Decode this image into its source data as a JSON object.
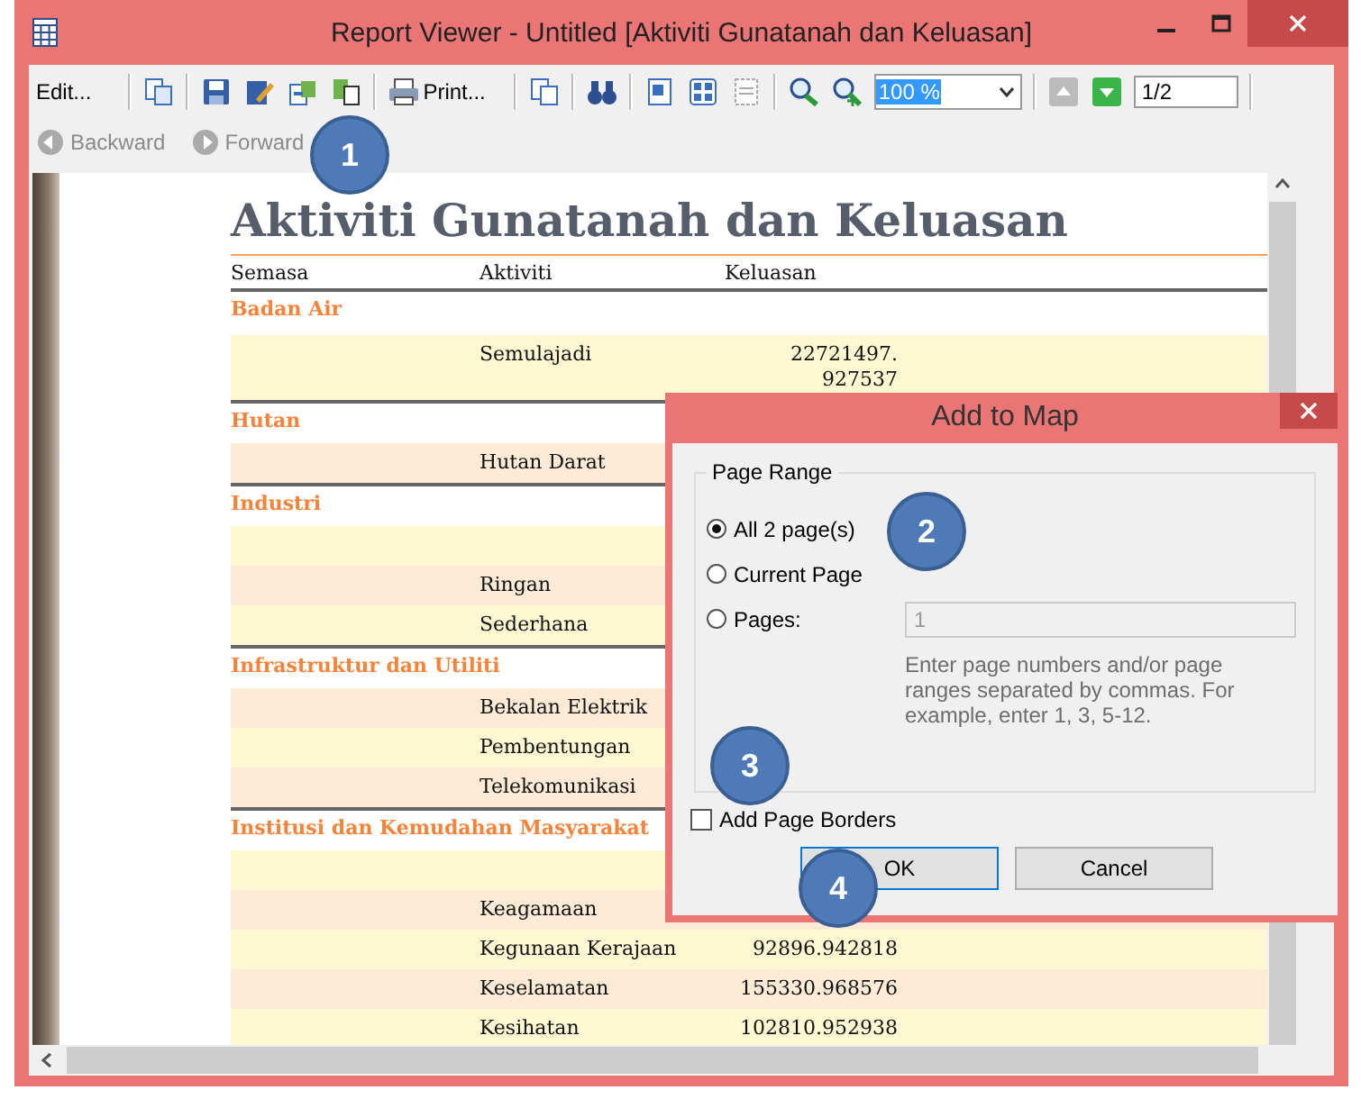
{
  "window": {
    "title": "Report Viewer - Untitled [Aktiviti Gunatanah dan Keluasan]"
  },
  "toolbar": {
    "edit": "Edit...",
    "print": "Print...",
    "zoom": "100 %",
    "page": "1/2"
  },
  "nav": [
    {
      "label": "Backward",
      "disabled": true
    },
    {
      "label": "Forward",
      "disabled": true
    }
  ],
  "report": {
    "title": "Aktiviti Gunatanah dan Keluasan",
    "columns": [
      "Semasa",
      "Aktiviti",
      "Keluasan"
    ],
    "groups": [
      {
        "name": "Badan Air",
        "rows": [
          {
            "activity": "Semulajadi",
            "area": "22721497.\n927537"
          }
        ]
      },
      {
        "name": "Hutan",
        "rows": [
          {
            "activity": "Hutan Darat"
          }
        ]
      },
      {
        "name": "Industri",
        "rows": [
          {},
          {
            "activity": "Ringan"
          },
          {
            "activity": "Sederhana"
          }
        ]
      },
      {
        "name": "Infrastruktur dan Utiliti",
        "rows": [
          {
            "activity": "Bekalan Elektrik"
          },
          {
            "activity": "Pembentungan"
          },
          {
            "activity": "Telekomunikasi"
          }
        ]
      },
      {
        "name": "Institusi dan Kemudahan Masyarakat",
        "rows": [
          {},
          {
            "activity": "Keagamaan"
          },
          {
            "activity": "Kegunaan Kerajaan",
            "area": "92896.942818"
          },
          {
            "activity": "Keselamatan",
            "area": "155330.968576"
          },
          {
            "activity": "Kesihatan",
            "area": "102810.952938"
          }
        ]
      }
    ]
  },
  "dialog": {
    "title": "Add to Map",
    "group": "Page Range",
    "options": [
      {
        "label": "All 2 page(s)",
        "selected": true
      },
      {
        "label": "Current Page",
        "selected": false
      },
      {
        "label": "Pages:",
        "selected": false
      }
    ],
    "pages_field": {
      "value": "1",
      "disabled": true
    },
    "hint": "Enter page numbers and/or page ranges separated by commas. For example, enter 1, 3, 5-12.",
    "checkbox": {
      "label": "Add Page Borders",
      "checked": false
    },
    "buttons": [
      "OK",
      "Cancel"
    ]
  },
  "callouts": [
    "1",
    "2",
    "3",
    "4"
  ]
}
